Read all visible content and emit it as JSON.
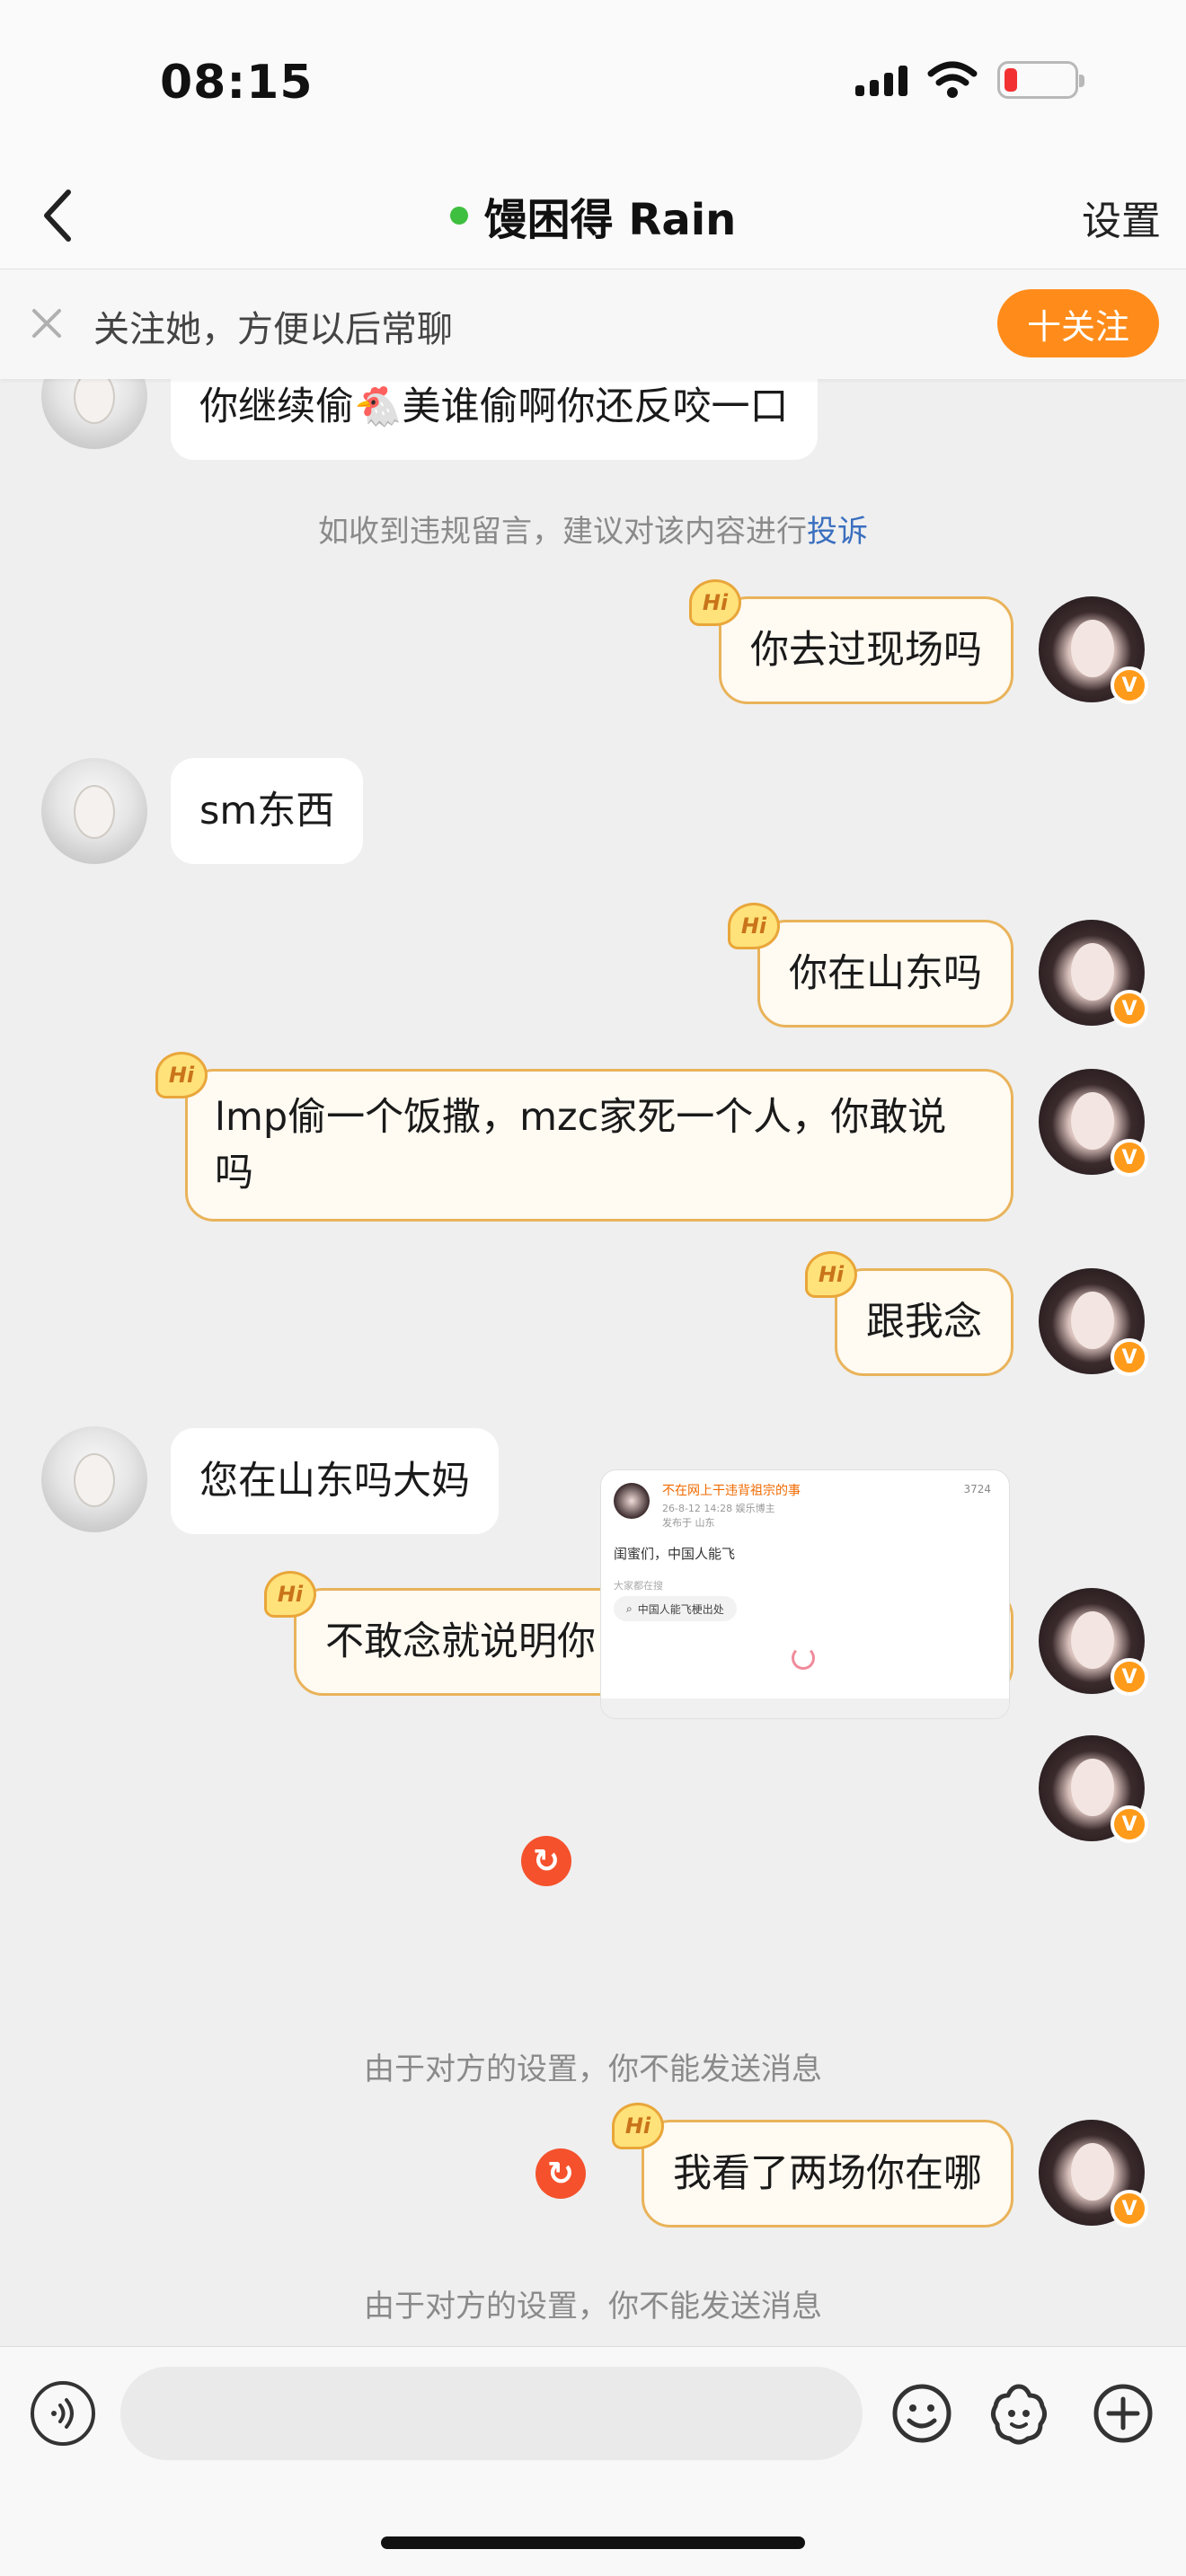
{
  "status_bar": {
    "time": "08:15"
  },
  "header": {
    "title": "馒困得 Rain",
    "settings_label": "设置"
  },
  "follow_banner": {
    "text": "关注她，方便以后常聊",
    "button_label": "十关注"
  },
  "messages": {
    "m1": "你继续偷🐔美谁偷啊你还反咬一口",
    "sys1_text": "如收到违规留言，建议对该内容进行",
    "sys1_link": "投诉",
    "m2": "你去过现场吗",
    "m3": "sm东西",
    "m4": "你在山东吗",
    "m5": "lmp偷一个饭撒，mzc家死一个人，你敢说吗",
    "m6": "跟我念",
    "m7": "您在山东吗大妈",
    "m8": "不敢念就说明你自己也清楚到底咋回事",
    "sys2": "由于对方的设置，你不能发送消息",
    "m9": "我看了两场你在哪",
    "sys3": "由于对方的设置，你不能发送消息",
    "hi_label": "Hi"
  },
  "share_card": {
    "author": "不在网上干违背祖宗的事",
    "meta": "26-8-12 14:28 娱乐博主",
    "meta2": "发布于 山东",
    "count": "3724",
    "text": "闺蜜们，中国人能飞",
    "search_label": "大家都在搜",
    "search_pill": "中国人能飞梗出处"
  },
  "input": {
    "placeholder": ""
  },
  "colors": {
    "accent": "#ff8c1a",
    "bubble_border": "#e9b35a",
    "error": "#f4512c",
    "link": "#3a6fbf"
  },
  "icons": [
    "back-icon",
    "close-icon",
    "voice-icon",
    "emoji-icon",
    "sticker-icon",
    "plus-icon",
    "resend-icon",
    "verified-icon"
  ]
}
